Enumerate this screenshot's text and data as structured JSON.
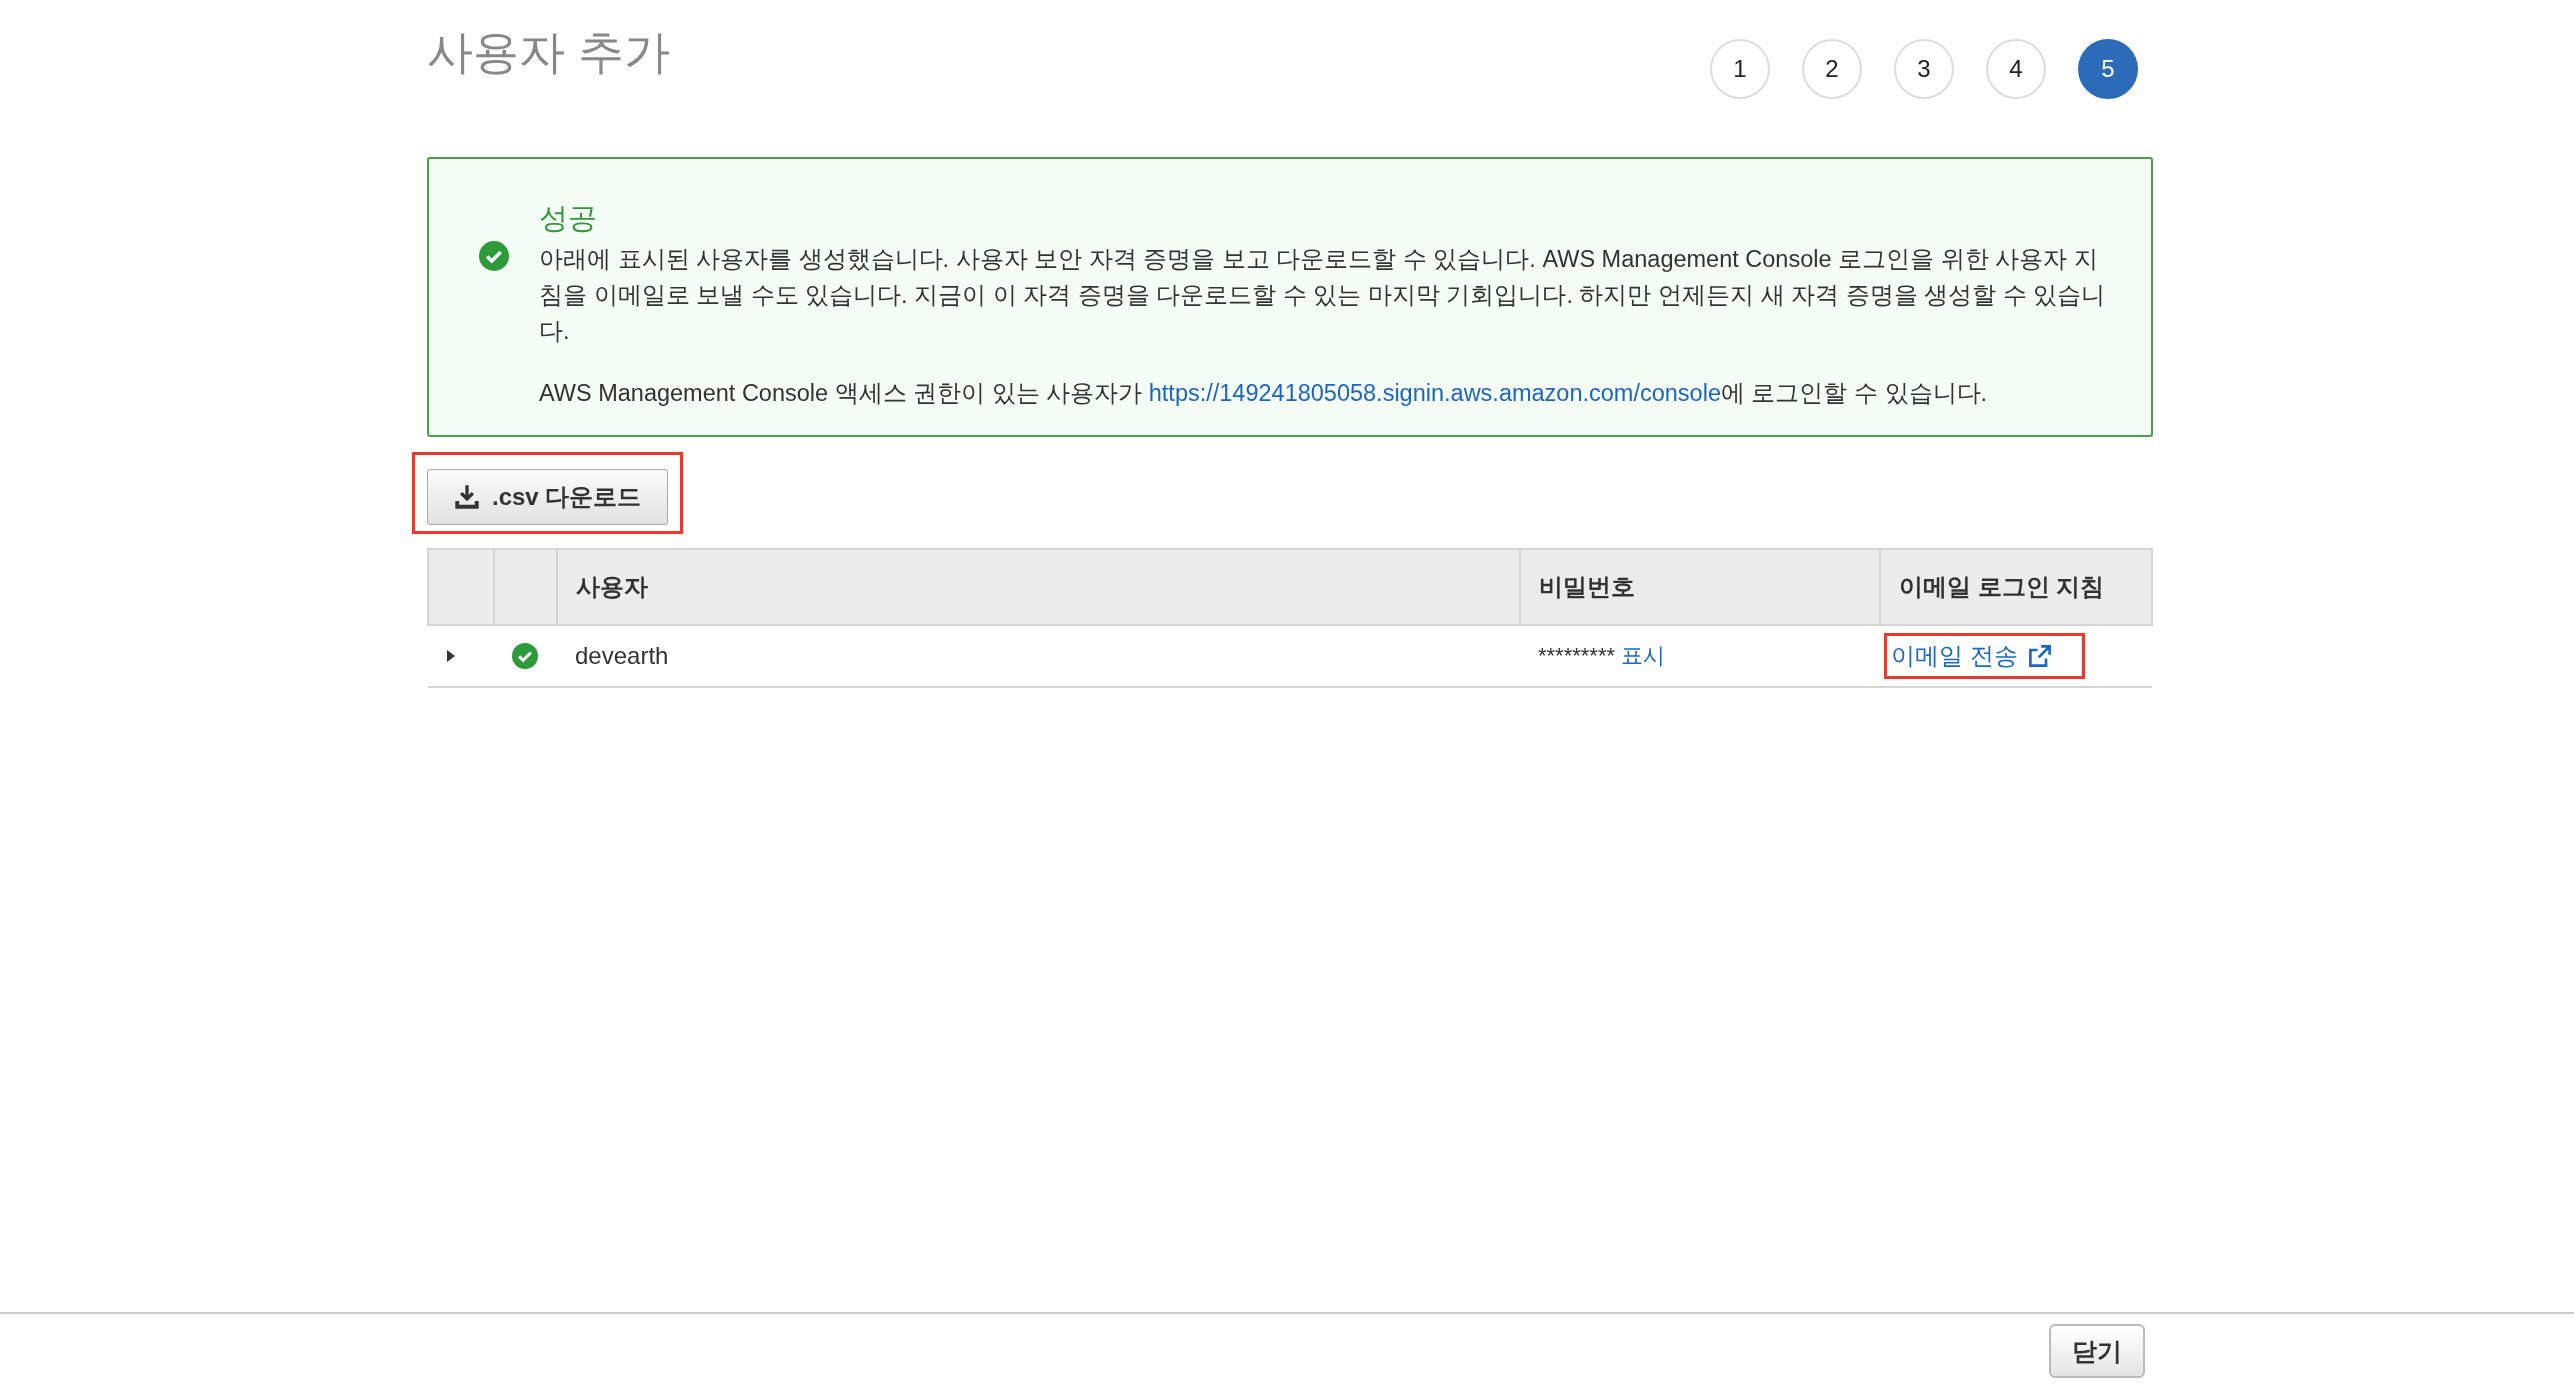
{
  "page": {
    "title": "사용자 추가"
  },
  "steps": [
    {
      "label": "1",
      "selected": false
    },
    {
      "label": "2",
      "selected": false
    },
    {
      "label": "3",
      "selected": false
    },
    {
      "label": "4",
      "selected": false
    },
    {
      "label": "5",
      "selected": true
    }
  ],
  "alert": {
    "title": "성공",
    "body": "아래에 표시된 사용자를 생성했습니다. 사용자 보안 자격 증명을 보고 다운로드할 수 있습니다. AWS Management Console 로그인을 위한 사용자 지침을 이메일로 보낼 수도 있습니다. 지금이 이 자격 증명을 다운로드할 수 있는 마지막 기회입니다. 하지만 언제든지 새 자격 증명을 생성할 수 있습니다.",
    "console_prefix": "AWS Management Console 액세스 권한이 있는 사용자가 ",
    "console_url": "https://149241805058.signin.aws.amazon.com/console",
    "console_suffix": "에 로그인할 수 있습니다."
  },
  "download_button": {
    "label": ".csv 다운로드"
  },
  "table": {
    "columns": [
      "사용자",
      "비밀번호",
      "이메일 로그인 지침"
    ],
    "rows": [
      {
        "expanded": false,
        "user": "devearth",
        "password": "*********",
        "show_link": "표시",
        "email_link": "이메일 전송"
      }
    ]
  },
  "close_button": {
    "label": "닫기"
  }
}
